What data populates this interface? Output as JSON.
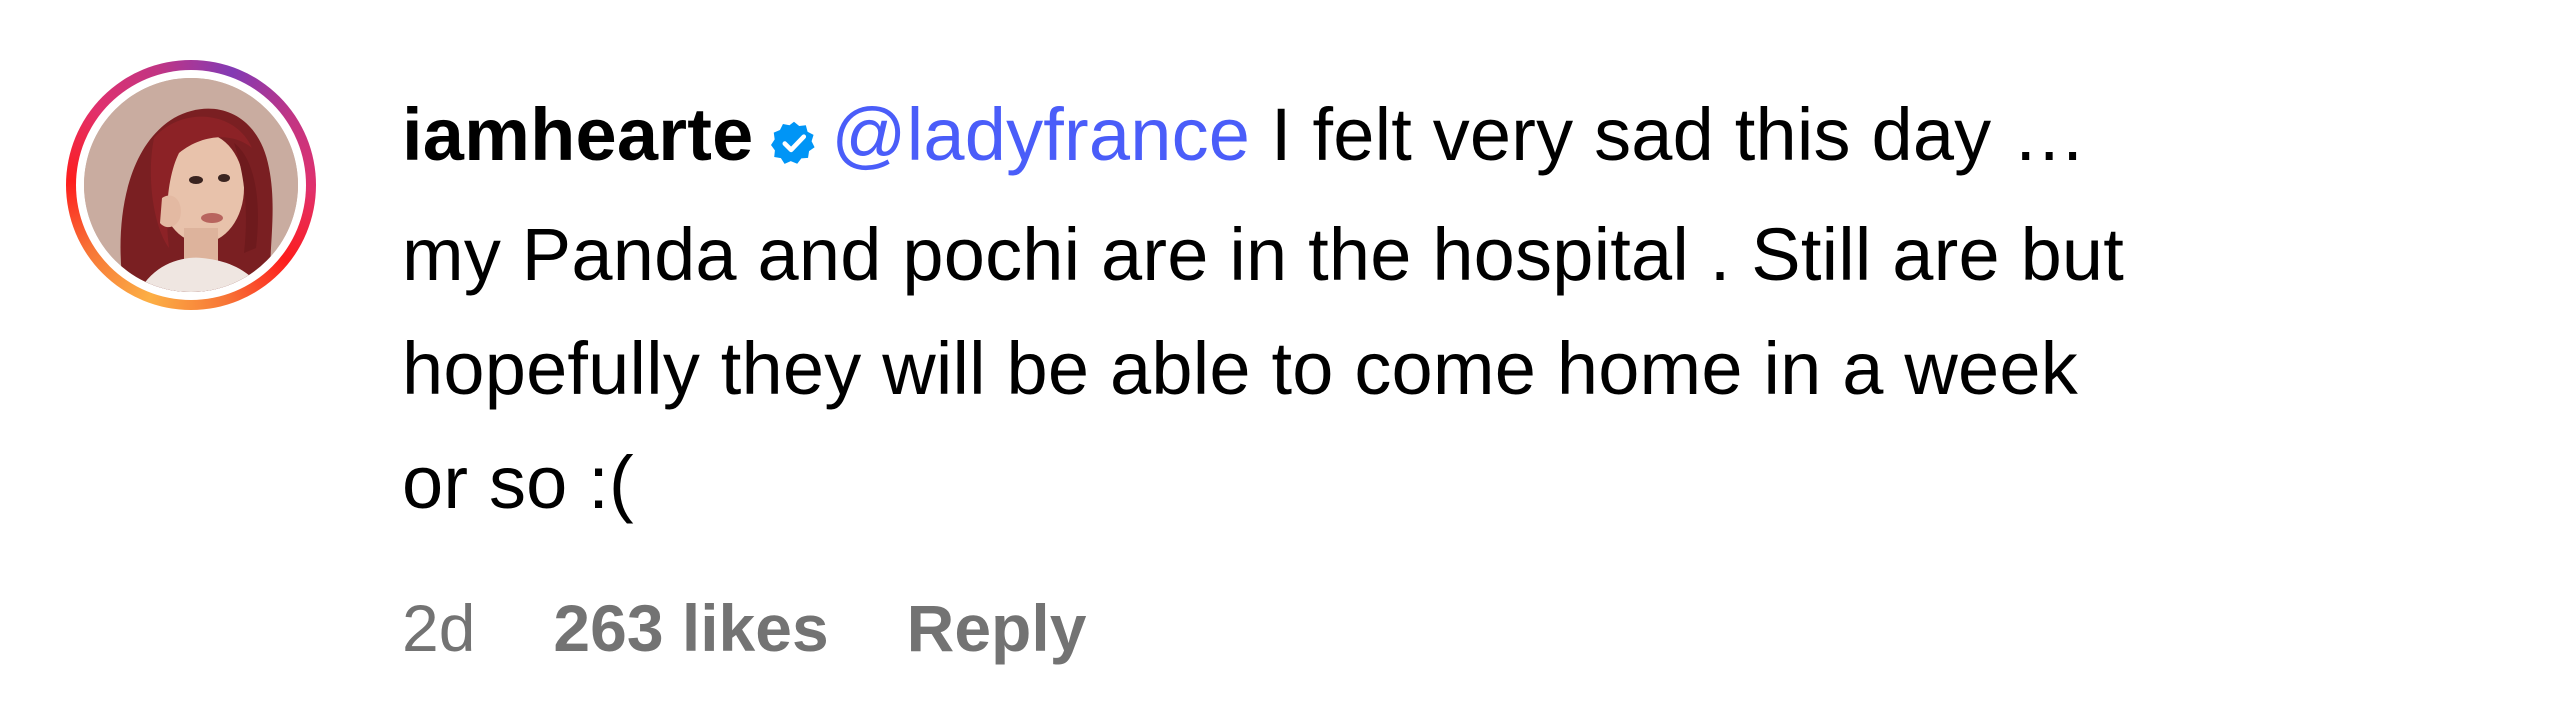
{
  "comment": {
    "username": "iamhearte",
    "verified_icon": "verified-badge-icon",
    "mention": "@ladyfrance",
    "text_lines": [
      " I felt very sad this day …",
      "my Panda and pochi are in the hospital . Still are but",
      "hopefully they will be able to come home in a week",
      "or so :("
    ],
    "time": "2d",
    "likes": "263 likes",
    "reply_label": "Reply"
  },
  "colors": {
    "mention": "#4a5df9",
    "verified": "#0095f6",
    "meta": "#737373"
  }
}
